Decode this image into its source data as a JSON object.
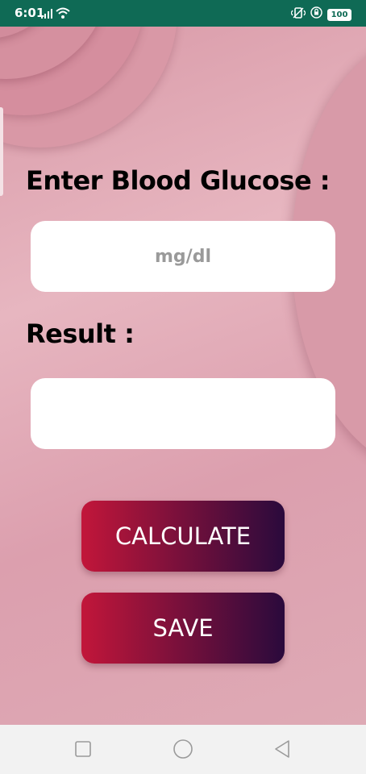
{
  "status_bar": {
    "time": "6:01",
    "battery": "100",
    "icons": [
      "signal-icon",
      "wifi-icon",
      "vibrate-icon",
      "lock-rotation-icon",
      "battery-icon"
    ],
    "color": "#0f6a55"
  },
  "form": {
    "glucose_label": "Enter Blood Glucose :",
    "glucose_placeholder": "mg/dl",
    "glucose_value": "",
    "result_label": "Result :",
    "result_value": ""
  },
  "buttons": {
    "calculate": "CALCULATE",
    "save": "SAVE",
    "gradient_start": "#c2163a",
    "gradient_end": "#2a0a3c"
  },
  "nav_bar": {
    "icons": [
      "recents-square-icon",
      "home-circle-icon",
      "back-triangle-icon"
    ]
  }
}
